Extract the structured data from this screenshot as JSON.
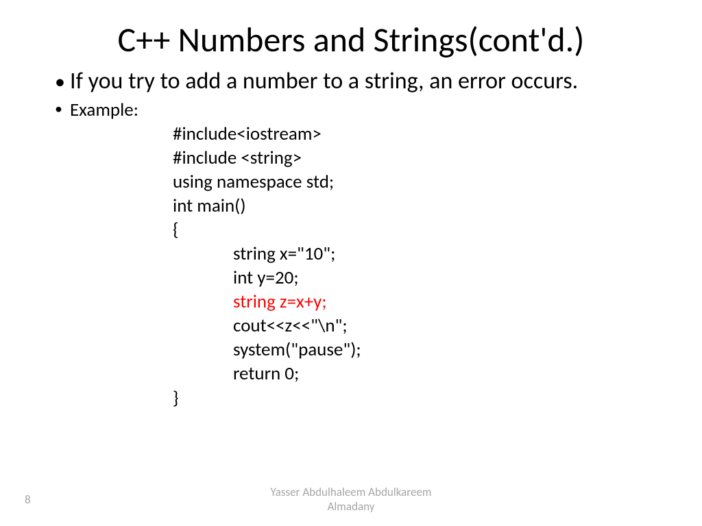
{
  "title": "C++ Numbers and Strings(cont'd.)",
  "bullets": {
    "b1": "If you try to add a number to a string, an error occurs.",
    "b2": "Example:"
  },
  "code": {
    "l1": "#include<iostream>",
    "l2": "#include <string>",
    "l3": "using namespace std;",
    "l4": "int main()",
    "l5": "{",
    "l6": "string x=\"10\";",
    "l7": "int y=20;",
    "l8": "string z=x+y;",
    "l9": "cout<<z<<\"\\n\";",
    "l10": "system(\"pause\");",
    "l11": "return 0;",
    "l12": "}"
  },
  "footer": {
    "author_line1": "Yasser Abdulhaleem Abdulkareem",
    "author_line2": "Almadany",
    "page": "8"
  }
}
